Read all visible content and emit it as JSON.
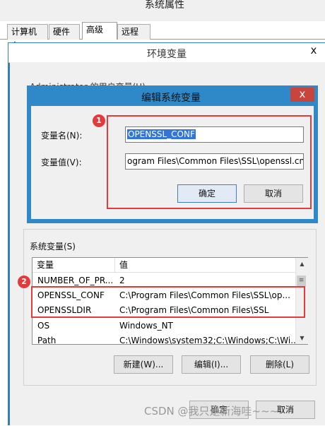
{
  "outer": {
    "title": "系统属性",
    "tabs": [
      {
        "label": "计算机名",
        "active": false
      },
      {
        "label": "硬件",
        "active": false
      },
      {
        "label": "高级",
        "active": true
      },
      {
        "label": "远程",
        "active": false
      }
    ]
  },
  "env_dialog": {
    "title": "环境变量",
    "close_glyph": "x",
    "user_vars_label": "Administrator 的用户变量(U)"
  },
  "edit_dialog": {
    "title": "编辑系统变量",
    "close_glyph": "x",
    "name_label": "变量名(N):",
    "name_value": "OPENSSL_CONF",
    "value_label": "变量值(V):",
    "value_value": "ogram Files\\Common Files\\SSL\\openssl.cnf",
    "ok_button": "确定",
    "cancel_button": "取消",
    "badge": "1"
  },
  "system_vars": {
    "label": "系统变量(S)",
    "columns": [
      "变量",
      "值"
    ],
    "rows": [
      {
        "name": "NUMBER_OF_PR...",
        "value": "2"
      },
      {
        "name": "OPENSSL_CONF",
        "value": "C:\\Program Files\\Common Files\\SSL\\op..."
      },
      {
        "name": "OPENSSLDIR",
        "value": "C:\\Program Files\\Common Files\\SSL"
      },
      {
        "name": "OS",
        "value": "Windows_NT"
      },
      {
        "name": "Path",
        "value": "C:\\Windows\\system32;C:\\Windows;C:\\Wi..."
      }
    ],
    "new_button": "新建(W)...",
    "edit_button": "编辑(I)...",
    "delete_button": "删除(L)",
    "badge": "2",
    "scroll_up_glyph": "▲",
    "scroll_down_glyph": "▼",
    "thumb_glyph": "≡"
  },
  "footer": {
    "ok_button": "确定",
    "cancel_button": "取消"
  },
  "watermark": "CSDN @我只是新海哇~~~",
  "colors": {
    "title_blue": "#2f88c8",
    "highlight_red": "#e33b3b",
    "selection_blue": "#3375d6"
  }
}
